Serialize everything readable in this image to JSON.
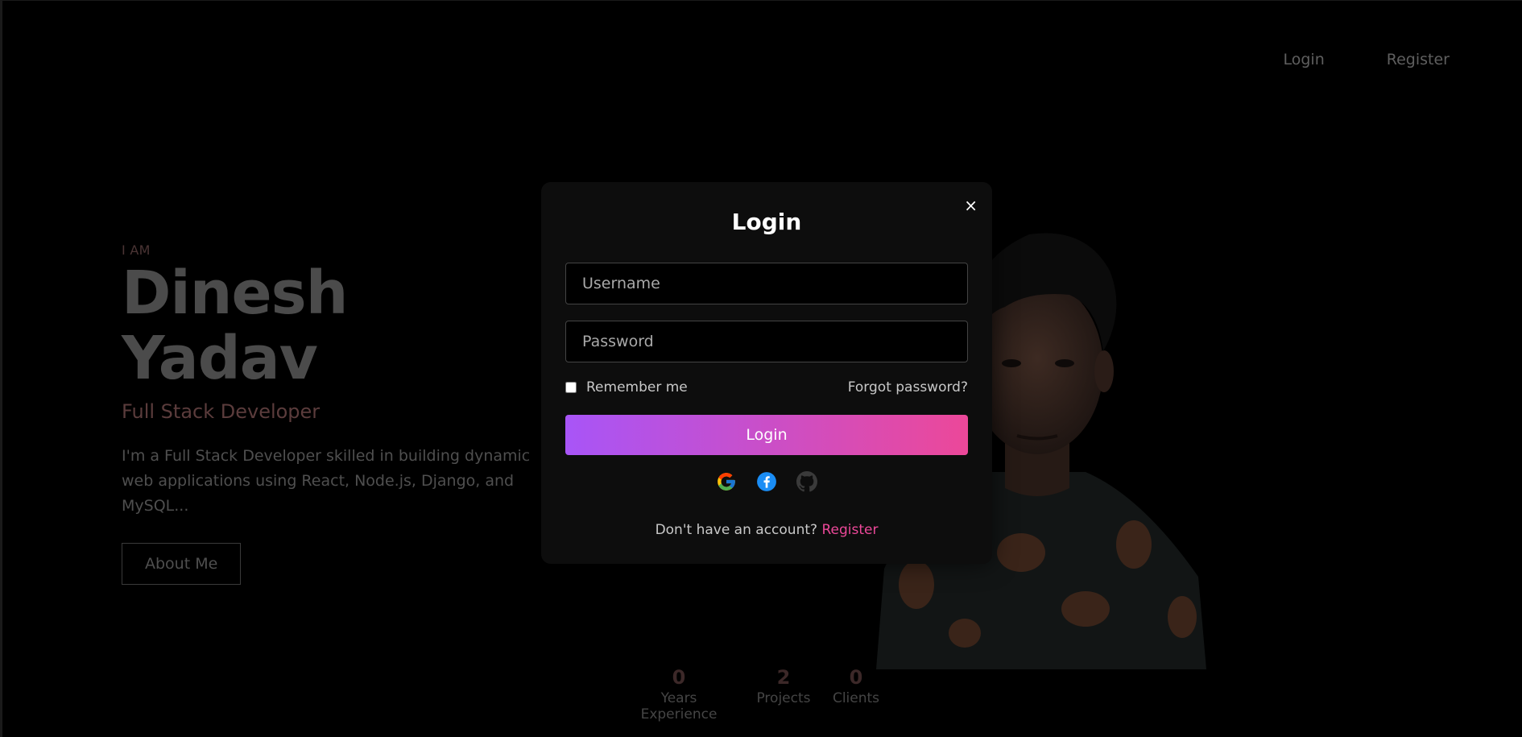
{
  "nav": {
    "login": "Login",
    "register": "Register"
  },
  "hero": {
    "eyebrow": "I AM",
    "name": "Dinesh Yadav",
    "role": "Full Stack Developer",
    "description": "I'm a Full Stack Developer skilled in building dynamic web applications using React, Node.js, Django, and MySQL...",
    "about_button": "About Me"
  },
  "stats": [
    {
      "value": "0",
      "label": "Years Experience"
    },
    {
      "value": "2",
      "label": "Projects"
    },
    {
      "value": "0",
      "label": "Clients"
    }
  ],
  "modal": {
    "close": "×",
    "title": "Login",
    "username_placeholder": "Username",
    "password_placeholder": "Password",
    "remember_label": "Remember me",
    "forgot_label": "Forgot password?",
    "submit_label": "Login",
    "social": [
      "google-icon",
      "facebook-icon",
      "github-icon"
    ],
    "footer_text": "Don't have an account?",
    "register_link": "Register"
  },
  "colors": {
    "accent_start": "#a855f7",
    "accent_end": "#ec4899",
    "link": "#ec4899"
  }
}
